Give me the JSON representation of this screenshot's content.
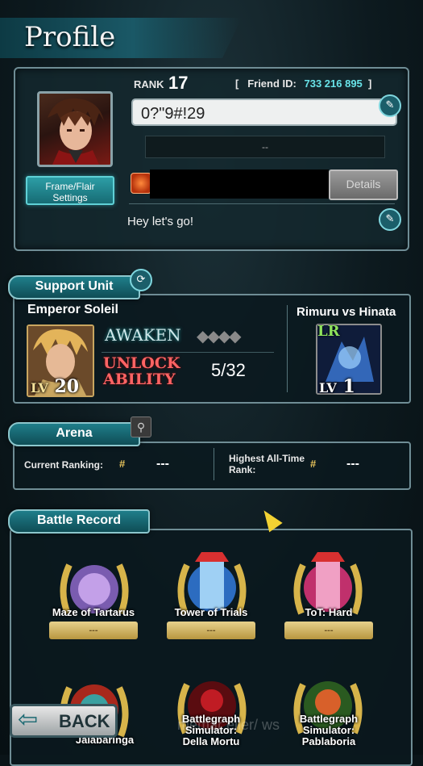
{
  "header": {
    "title": "Profile"
  },
  "profile": {
    "rank_label": "RANK",
    "rank_value": "17",
    "friend_id_label": "Friend ID:",
    "friend_id_value": "733 216 895",
    "name": "0?\"9#!29",
    "guild_placeholder": "--",
    "frame_button": "Frame/Flair Settings",
    "details_button": "Details",
    "comment": "Hey let's go!"
  },
  "support_unit": {
    "tab_label": "Support Unit",
    "unit_name": "Emperor Soleil",
    "unit_level_label": "LV",
    "unit_level": "20",
    "awaken_label": "AWAKEN",
    "unlock_line1": "UNLOCK",
    "unlock_line2": "ABILITY",
    "ability_progress": "5/32",
    "awaken_stars_filled": 0,
    "awaken_stars_total": 4,
    "vision_name": "Rimuru vs Hinata",
    "vision_rarity": "LR",
    "vision_level_label": "LV",
    "vision_level": "1"
  },
  "arena": {
    "tab_label": "Arena",
    "current_ranking_label": "Current Ranking:",
    "current_ranking_value": "---",
    "highest_rank_label_line1": "Highest All-Time",
    "highest_rank_label_line2": "Rank:",
    "highest_rank_value": "---"
  },
  "battle_record": {
    "tab_label": "Battle Record",
    "items": [
      {
        "label": "Maze of Tartarus",
        "value": "---"
      },
      {
        "label": "Tower of Trials",
        "value": "---"
      },
      {
        "label": "ToT: Hard",
        "value": "---"
      },
      {
        "label_line1": "",
        "label_line2": "Jalabaringa"
      },
      {
        "label_line1": "Battlegraph Simulator:",
        "label_line2": "Della Mortu"
      },
      {
        "label_line1": "Battlegraph Simulator:",
        "label_line2": "Pablaboria"
      }
    ]
  },
  "footer": {
    "back_button": "BACK",
    "watermark": "memar    eller/      ws"
  },
  "colors": {
    "accent_teal": "#68e3e8",
    "panel_border": "#6f8d95",
    "gold": "#c9a660",
    "unlock_red": "#ff6464"
  }
}
